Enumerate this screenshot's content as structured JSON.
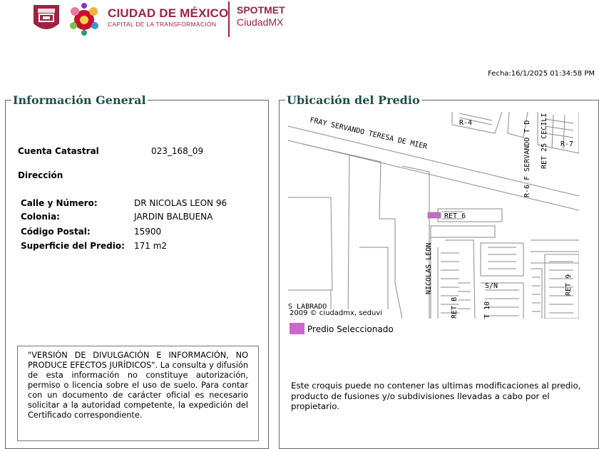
{
  "header": {
    "brand_main": "CIUDAD DE MÉXICO",
    "brand_sub": "CAPITAL DE LA TRANSFORMACIÓN",
    "app_name_1": "SPOTMET",
    "app_name_2": "CiudadMX",
    "brand_color": "#9f2241"
  },
  "fecha": "Fecha:16/1/2025 01:34:58 PM",
  "info_general": {
    "title": "Información General",
    "cuenta_label": "Cuenta Catastral",
    "cuenta_value": "023_168_09",
    "direccion_label": "Dirección",
    "calle_label": "Calle y Número:",
    "calle_value": "DR NICOLAS LEON 96",
    "colonia_label": "Colonia:",
    "colonia_value": "JARDIN BALBUENA",
    "cp_label": "Código Postal:",
    "cp_value": "15900",
    "superficie_label": "Superficie del Predio:",
    "superficie_value": "171 m2",
    "disclaimer": "\"VERSIÓN DE DIVULGACIÓN E INFORMACIÓN, NO PRODUCE EFECTOS JURÍDICOS\". La consulta y difusión de esta información no constituye autorización, permiso o licencia sobre el uso de suelo. Para contar con un documento de carácter oficial es necesario solicitar a la autoridad competente, la expedición del Certificado correspondiente."
  },
  "ubicacion": {
    "title": "Ubicación del Predio",
    "map_labels": {
      "fray": "FRAY SERVANDO TERESA DE MIER",
      "r4": "R-4",
      "r6": "R-6 F SERVANDO T D",
      "ret25": "RET 25 CECILI",
      "r7": "R-7",
      "ret6": "RET 6",
      "nicolas": "NICOLAS LEON",
      "sn": "S/N",
      "retb": "RET B",
      "ret10": "T 10",
      "ret9": "RET 9",
      "labrad": "S LABRADO"
    },
    "map_credit": "2009 © ciudadmx, seduvi",
    "legend_label": "Predio Seleccionado",
    "legend_color": "#cc66cc",
    "croquis_note": "Este croquis puede no contener las ultimas modificaciones al predio, producto de fusiones y/o subdivisiones llevadas a cabo por el propietario."
  }
}
